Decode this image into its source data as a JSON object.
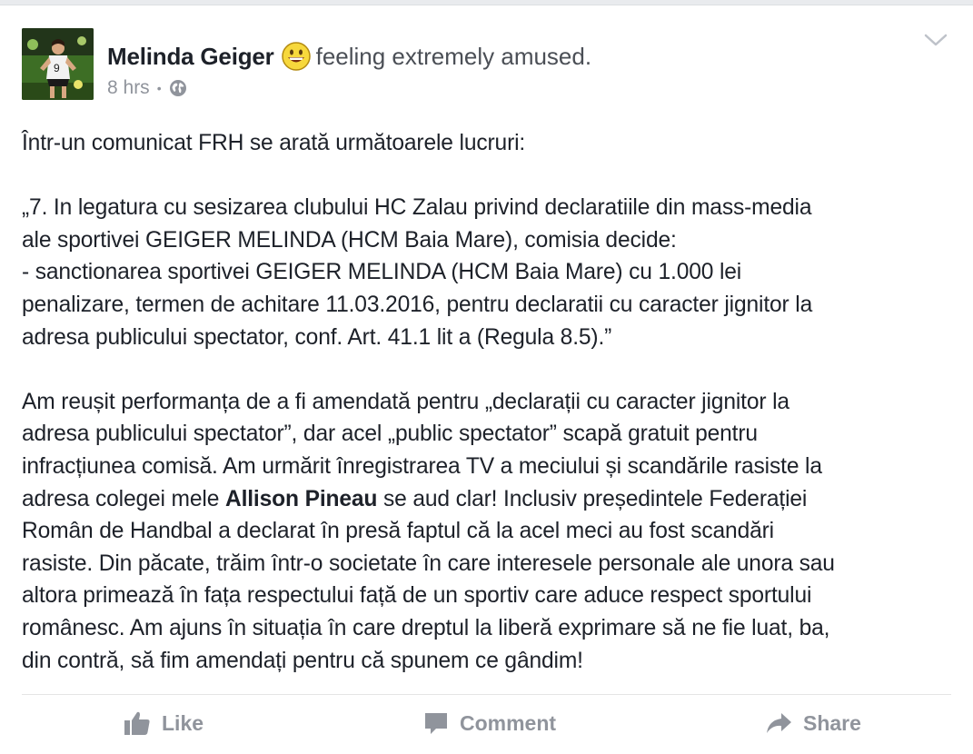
{
  "post": {
    "author": "Melinda Geiger",
    "feeling_icon": "grinning-face-emoji",
    "feeling": "feeling extremely amused.",
    "time": "8 hrs",
    "separator": "•",
    "privacy_icon": "globe-icon",
    "options_icon": "chevron-down-icon",
    "lines": [
      "Într-un comunicat FRH se arată următoarele lucruri:",
      "",
      "„7. In legatura cu  sesizarea clubului HC Zalau privind declaratiile din mass-media",
      "ale sportivei GEIGER MELINDA (HCM Baia Mare), comisia decide:",
      "- sanctionarea sportivei  GEIGER MELINDA (HCM Baia Mare) cu 1.000 lei",
      "penalizare, termen de achitare 11.03.2016, pentru declaratii cu caracter jignitor la",
      "adresa publicului spectator,  conf. Art. 41.1 lit a (Regula 8.5).”",
      "",
      "Am reușit performanța de a fi amendată pentru „declarații cu caracter jignitor la",
      "adresa publicului spectator”, dar acel „public spectator” scapă gratuit pentru",
      "infracțiunea comisă. Am urmărit înregistrarea TV a meciului și scandările rasiste la",
      "adresa colegei mele ",
      "Român de Handbal a declarat în presă faptul că la acel meci au fost scandări",
      "rasiste. Din păcate, trăim într-o societate în care interesele personale ale unora sau",
      "altora primează în fața respectului față de un sportiv care aduce respect sportului",
      "românesc. Am ajuns în situația în care dreptul la liberă exprimare să ne fie luat, ba,",
      "din contră, să fim amendați pentru că spunem ce gândim!"
    ],
    "mention": "Allison Pineau",
    "mention_tail": " se aud clar! Inclusiv președintele Federației"
  },
  "actions": {
    "like": "Like",
    "comment": "Comment",
    "share": "Share"
  },
  "colors": {
    "text": "#1d2129",
    "muted": "#90949c",
    "background": "#ffffff",
    "page": "#e9ebee"
  }
}
